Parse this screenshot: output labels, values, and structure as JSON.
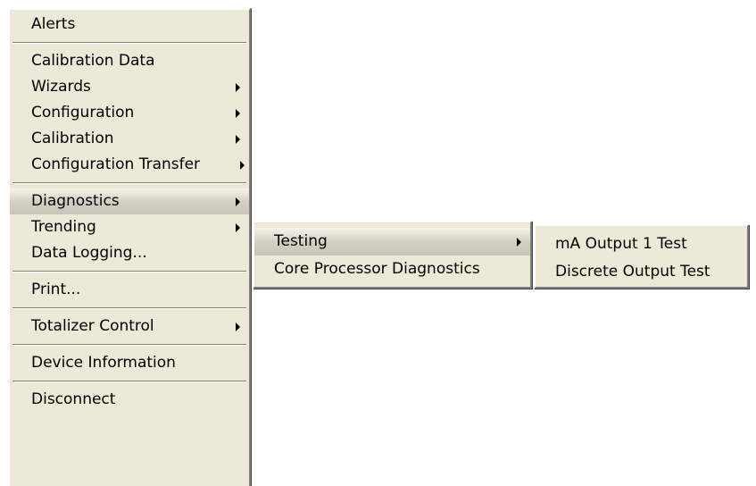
{
  "main_menu": {
    "items": [
      {
        "label": "Alerts"
      },
      {
        "label": "Calibration Data"
      },
      {
        "label": "Wizards"
      },
      {
        "label": "Configuration"
      },
      {
        "label": "Calibration"
      },
      {
        "label": "Configuration Transfer"
      },
      {
        "label": "Diagnostics"
      },
      {
        "label": "Trending"
      },
      {
        "label": "Data Logging..."
      },
      {
        "label": "Print..."
      },
      {
        "label": "Totalizer Control"
      },
      {
        "label": "Device Information"
      },
      {
        "label": "Disconnect"
      }
    ]
  },
  "diagnostics_submenu": {
    "items": [
      {
        "label": "Testing"
      },
      {
        "label": "Core Processor Diagnostics"
      }
    ]
  },
  "testing_submenu": {
    "items": [
      {
        "label": "mA Output 1 Test"
      },
      {
        "label": "Discrete Output Test"
      }
    ]
  },
  "colors": {
    "menu_background": "#ece9d8",
    "highlight": "#d4d0c4",
    "separator": "#808080"
  }
}
